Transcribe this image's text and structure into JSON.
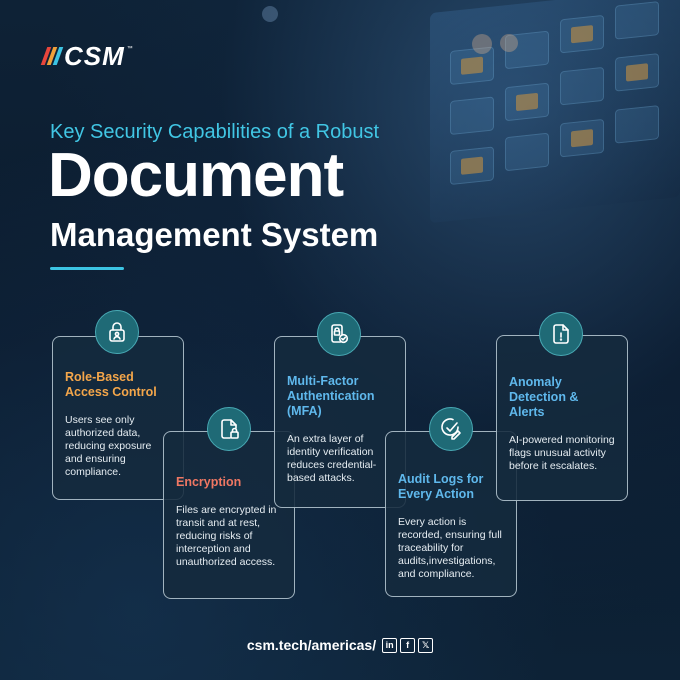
{
  "brand": {
    "logo_text": "CSM",
    "trademark": "™",
    "bar_colors": [
      "#e8463c",
      "#f0a13a",
      "#3cc4e3"
    ]
  },
  "header": {
    "kicker": "Key Security Capabilities of a Robust",
    "title_line1": "Document",
    "title_line2": "Management System"
  },
  "colors": {
    "accent_cyan": "#3cc4e3",
    "orange": "#f4a64a",
    "coral": "#ef7763",
    "light_blue": "#5fb8ec",
    "icon_bg": "#1f6a76"
  },
  "cards": [
    {
      "title": "Role-Based Access Control",
      "description": "Users see only authorized data, reducing exposure and ensuring compliance.",
      "title_color": "#f4a64a",
      "icon": "user-lock-icon"
    },
    {
      "title": "Encryption",
      "description": "Files are encrypted in transit and at rest, reducing risks of interception and unauthorized access.",
      "title_color": "#ef7763",
      "icon": "file-lock-icon"
    },
    {
      "title": "Multi-Factor Authentication (MFA)",
      "description": "An extra layer of identity verification reduces credential-based attacks.",
      "title_color": "#5fb8ec",
      "icon": "phone-check-icon"
    },
    {
      "title": "Audit Logs for Every Action",
      "description": "Every action is recorded, ensuring full traceability for audits,investigations, and compliance.",
      "title_color": "#5fb8ec",
      "icon": "check-edit-icon"
    },
    {
      "title": "Anomaly Detection & Alerts",
      "description": "AI-powered monitoring flags unusual activity before it escalates.",
      "title_color": "#5fb8ec",
      "icon": "file-alert-icon"
    }
  ],
  "footer": {
    "url": "csm.tech/americas/",
    "social": [
      {
        "label": "in",
        "icon": "linkedin-icon"
      },
      {
        "label": "f",
        "icon": "facebook-icon"
      },
      {
        "label": "𝕏",
        "icon": "x-icon"
      }
    ]
  }
}
